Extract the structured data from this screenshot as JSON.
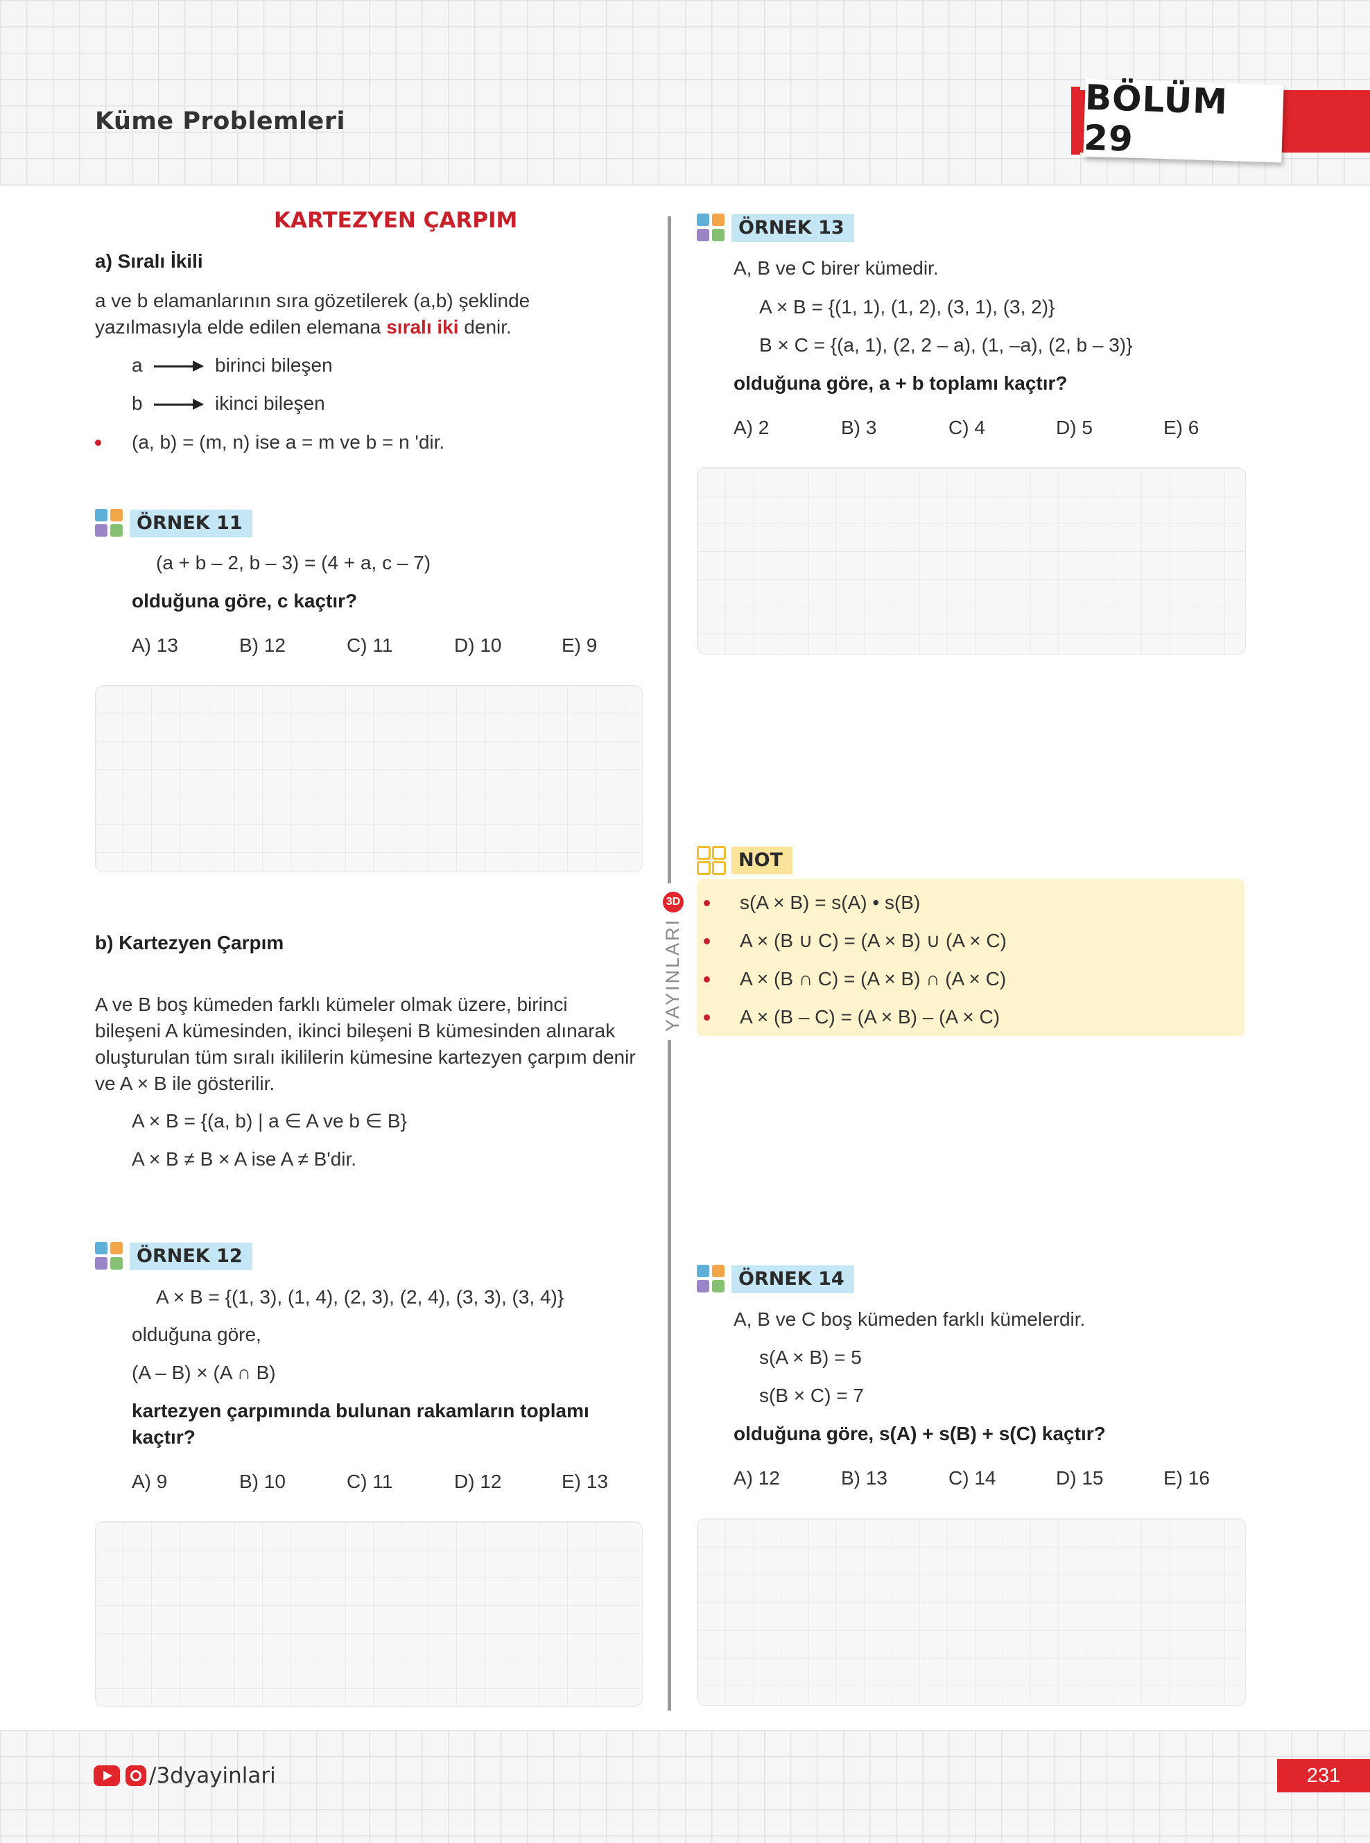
{
  "header": {
    "title": "Küme Problemleri",
    "chapter": "BÖLÜM 29"
  },
  "side_brand": {
    "text": "YAYINLARI",
    "logo": "3D"
  },
  "left": {
    "section_title": "KARTEZYEN ÇARPIM",
    "a_heading": "a) Sıralı İkili",
    "a_text_1": "a ve b elamanlarının sıra gözetilerek (a,b) şeklinde",
    "a_text_2_pre": "yazılmasıyla elde edilen elemana",
    "a_text_2_highlight": "sıralı iki",
    "a_text_2_post": "denir.",
    "arrow_rows": [
      {
        "var": "a",
        "label": "birinci bileşen"
      },
      {
        "var": "b",
        "label": "ikinci bileşen"
      }
    ],
    "rule": "(a, b) = (m, n)  ise  a = m  ve  b = n 'dir.",
    "ornek11": {
      "label": "ÖRNEK 11",
      "equation": "(a + b – 2, b – 3) = (4 + a, c – 7)",
      "question": "olduğuna göre, c kaçtır?",
      "options": [
        "A) 13",
        "B) 12",
        "C) 11",
        "D) 10",
        "E) 9"
      ]
    },
    "b_heading": "b) Kartezyen Çarpım",
    "b_text": [
      "A ve B boş kümeden farklı kümeler olmak üzere, birinci",
      "bileşeni A kümesinden, ikinci bileşeni B kümesinden alınarak",
      "oluşturulan tüm sıralı ikililerin kümesine kartezyen çarpım denir",
      "ve A × B ile gösterilir."
    ],
    "b_formula_1": "A × B = {(a, b) | a ∈ A ve b ∈ B}",
    "b_formula_2": "A × B ≠ B × A ise A ≠ B'dir.",
    "ornek12": {
      "label": "ÖRNEK 12",
      "set": "A × B = {(1, 3), (1, 4), (2, 3), (2, 4), (3, 3), (3, 4)}",
      "line2": "olduğuna göre,",
      "line3": "(A – B) × (A ∩ B)",
      "question_1": "kartezyen çarpımında bulunan rakamların toplamı",
      "question_2": "kaçtır?",
      "options": [
        "A) 9",
        "B) 10",
        "C) 11",
        "D) 12",
        "E) 13"
      ]
    }
  },
  "right": {
    "ornek13": {
      "label": "ÖRNEK 13",
      "intro": "A, B ve C birer kümedir.",
      "line1": "A × B = {(1, 1), (1, 2), (3, 1), (3, 2)}",
      "line2": "B × C = {(a, 1), (2, 2 – a), (1, –a), (2, b – 3)}",
      "question": "olduğuna göre, a + b toplamı kaçtır?",
      "options": [
        "A) 2",
        "B) 3",
        "C) 4",
        "D) 5",
        "E) 6"
      ]
    },
    "not": {
      "label": "NOT",
      "items": [
        "s(A × B) = s(A) • s(B)",
        "A × (B ∪ C) = (A × B) ∪ (A × C)",
        "A × (B ∩ C) = (A × B) ∩ (A × C)",
        "A × (B – C) = (A × B) – (A × C)"
      ]
    },
    "ornek14": {
      "label": "ÖRNEK 14",
      "intro": "A, B ve C boş kümeden farklı kümelerdir.",
      "line1": "s(A × B) = 5",
      "line2": "s(B × C) = 7",
      "question": "olduğuna göre, s(A) + s(B) + s(C) kaçtır?",
      "options": [
        "A) 12",
        "B) 13",
        "C) 14",
        "D) 15",
        "E) 16"
      ]
    }
  },
  "footer": {
    "social": "/3dyayinlari",
    "page_number": "231"
  },
  "colors": {
    "accent_red": "#e0252c",
    "example_label_bg": "#c5e6f5",
    "note_bg": "#fdf3cc"
  },
  "icons": [
    "example-grid-icon",
    "note-grid-icon",
    "youtube-icon",
    "instagram-icon",
    "arrow-right-icon"
  ]
}
